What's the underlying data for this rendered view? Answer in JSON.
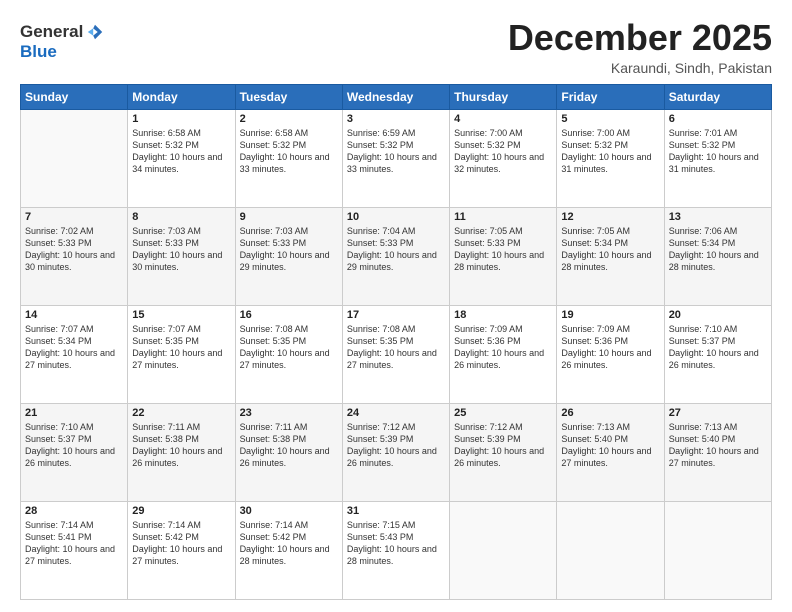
{
  "header": {
    "logo_general": "General",
    "logo_blue": "Blue",
    "month": "December 2025",
    "location": "Karaundi, Sindh, Pakistan"
  },
  "days_of_week": [
    "Sunday",
    "Monday",
    "Tuesday",
    "Wednesday",
    "Thursday",
    "Friday",
    "Saturday"
  ],
  "weeks": [
    [
      {
        "day": "",
        "sunrise": "",
        "sunset": "",
        "daylight": ""
      },
      {
        "day": "1",
        "sunrise": "Sunrise: 6:58 AM",
        "sunset": "Sunset: 5:32 PM",
        "daylight": "Daylight: 10 hours and 34 minutes."
      },
      {
        "day": "2",
        "sunrise": "Sunrise: 6:58 AM",
        "sunset": "Sunset: 5:32 PM",
        "daylight": "Daylight: 10 hours and 33 minutes."
      },
      {
        "day": "3",
        "sunrise": "Sunrise: 6:59 AM",
        "sunset": "Sunset: 5:32 PM",
        "daylight": "Daylight: 10 hours and 33 minutes."
      },
      {
        "day": "4",
        "sunrise": "Sunrise: 7:00 AM",
        "sunset": "Sunset: 5:32 PM",
        "daylight": "Daylight: 10 hours and 32 minutes."
      },
      {
        "day": "5",
        "sunrise": "Sunrise: 7:00 AM",
        "sunset": "Sunset: 5:32 PM",
        "daylight": "Daylight: 10 hours and 31 minutes."
      },
      {
        "day": "6",
        "sunrise": "Sunrise: 7:01 AM",
        "sunset": "Sunset: 5:32 PM",
        "daylight": "Daylight: 10 hours and 31 minutes."
      }
    ],
    [
      {
        "day": "7",
        "sunrise": "Sunrise: 7:02 AM",
        "sunset": "Sunset: 5:33 PM",
        "daylight": "Daylight: 10 hours and 30 minutes."
      },
      {
        "day": "8",
        "sunrise": "Sunrise: 7:03 AM",
        "sunset": "Sunset: 5:33 PM",
        "daylight": "Daylight: 10 hours and 30 minutes."
      },
      {
        "day": "9",
        "sunrise": "Sunrise: 7:03 AM",
        "sunset": "Sunset: 5:33 PM",
        "daylight": "Daylight: 10 hours and 29 minutes."
      },
      {
        "day": "10",
        "sunrise": "Sunrise: 7:04 AM",
        "sunset": "Sunset: 5:33 PM",
        "daylight": "Daylight: 10 hours and 29 minutes."
      },
      {
        "day": "11",
        "sunrise": "Sunrise: 7:05 AM",
        "sunset": "Sunset: 5:33 PM",
        "daylight": "Daylight: 10 hours and 28 minutes."
      },
      {
        "day": "12",
        "sunrise": "Sunrise: 7:05 AM",
        "sunset": "Sunset: 5:34 PM",
        "daylight": "Daylight: 10 hours and 28 minutes."
      },
      {
        "day": "13",
        "sunrise": "Sunrise: 7:06 AM",
        "sunset": "Sunset: 5:34 PM",
        "daylight": "Daylight: 10 hours and 28 minutes."
      }
    ],
    [
      {
        "day": "14",
        "sunrise": "Sunrise: 7:07 AM",
        "sunset": "Sunset: 5:34 PM",
        "daylight": "Daylight: 10 hours and 27 minutes."
      },
      {
        "day": "15",
        "sunrise": "Sunrise: 7:07 AM",
        "sunset": "Sunset: 5:35 PM",
        "daylight": "Daylight: 10 hours and 27 minutes."
      },
      {
        "day": "16",
        "sunrise": "Sunrise: 7:08 AM",
        "sunset": "Sunset: 5:35 PM",
        "daylight": "Daylight: 10 hours and 27 minutes."
      },
      {
        "day": "17",
        "sunrise": "Sunrise: 7:08 AM",
        "sunset": "Sunset: 5:35 PM",
        "daylight": "Daylight: 10 hours and 27 minutes."
      },
      {
        "day": "18",
        "sunrise": "Sunrise: 7:09 AM",
        "sunset": "Sunset: 5:36 PM",
        "daylight": "Daylight: 10 hours and 26 minutes."
      },
      {
        "day": "19",
        "sunrise": "Sunrise: 7:09 AM",
        "sunset": "Sunset: 5:36 PM",
        "daylight": "Daylight: 10 hours and 26 minutes."
      },
      {
        "day": "20",
        "sunrise": "Sunrise: 7:10 AM",
        "sunset": "Sunset: 5:37 PM",
        "daylight": "Daylight: 10 hours and 26 minutes."
      }
    ],
    [
      {
        "day": "21",
        "sunrise": "Sunrise: 7:10 AM",
        "sunset": "Sunset: 5:37 PM",
        "daylight": "Daylight: 10 hours and 26 minutes."
      },
      {
        "day": "22",
        "sunrise": "Sunrise: 7:11 AM",
        "sunset": "Sunset: 5:38 PM",
        "daylight": "Daylight: 10 hours and 26 minutes."
      },
      {
        "day": "23",
        "sunrise": "Sunrise: 7:11 AM",
        "sunset": "Sunset: 5:38 PM",
        "daylight": "Daylight: 10 hours and 26 minutes."
      },
      {
        "day": "24",
        "sunrise": "Sunrise: 7:12 AM",
        "sunset": "Sunset: 5:39 PM",
        "daylight": "Daylight: 10 hours and 26 minutes."
      },
      {
        "day": "25",
        "sunrise": "Sunrise: 7:12 AM",
        "sunset": "Sunset: 5:39 PM",
        "daylight": "Daylight: 10 hours and 26 minutes."
      },
      {
        "day": "26",
        "sunrise": "Sunrise: 7:13 AM",
        "sunset": "Sunset: 5:40 PM",
        "daylight": "Daylight: 10 hours and 27 minutes."
      },
      {
        "day": "27",
        "sunrise": "Sunrise: 7:13 AM",
        "sunset": "Sunset: 5:40 PM",
        "daylight": "Daylight: 10 hours and 27 minutes."
      }
    ],
    [
      {
        "day": "28",
        "sunrise": "Sunrise: 7:14 AM",
        "sunset": "Sunset: 5:41 PM",
        "daylight": "Daylight: 10 hours and 27 minutes."
      },
      {
        "day": "29",
        "sunrise": "Sunrise: 7:14 AM",
        "sunset": "Sunset: 5:42 PM",
        "daylight": "Daylight: 10 hours and 27 minutes."
      },
      {
        "day": "30",
        "sunrise": "Sunrise: 7:14 AM",
        "sunset": "Sunset: 5:42 PM",
        "daylight": "Daylight: 10 hours and 28 minutes."
      },
      {
        "day": "31",
        "sunrise": "Sunrise: 7:15 AM",
        "sunset": "Sunset: 5:43 PM",
        "daylight": "Daylight: 10 hours and 28 minutes."
      },
      {
        "day": "",
        "sunrise": "",
        "sunset": "",
        "daylight": ""
      },
      {
        "day": "",
        "sunrise": "",
        "sunset": "",
        "daylight": ""
      },
      {
        "day": "",
        "sunrise": "",
        "sunset": "",
        "daylight": ""
      }
    ]
  ]
}
